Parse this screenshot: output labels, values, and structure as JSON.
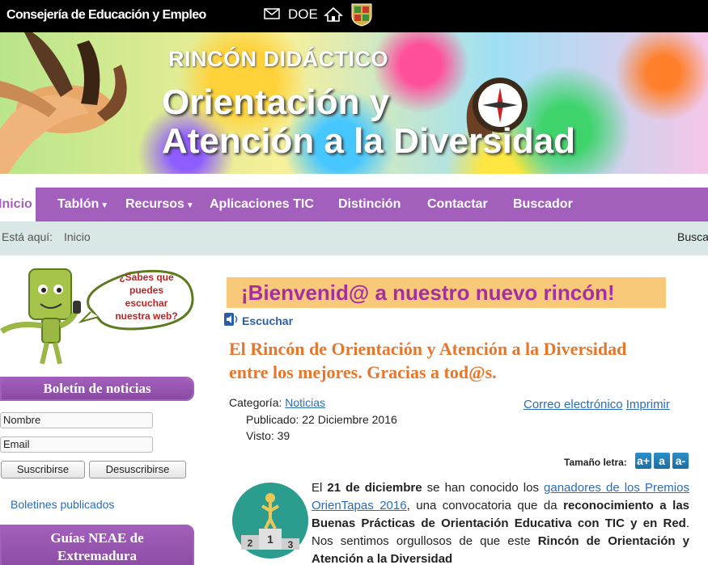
{
  "topbar": {
    "organization": "Consejería de Educación y Empleo",
    "doe_label": "DOE"
  },
  "banner": {
    "subtitle": "RINCÓN DIDÁCTICO",
    "title_line1": "Orientación y",
    "title_line2": "Atención a la Diversidad"
  },
  "nav": {
    "items": [
      {
        "label": "Inicio",
        "active": true
      },
      {
        "label": "Tablón",
        "dropdown": true
      },
      {
        "label": "Recursos",
        "dropdown": true
      },
      {
        "label": "Aplicaciones TIC"
      },
      {
        "label": "Distinción"
      },
      {
        "label": "Contactar"
      },
      {
        "label": "Buscador"
      }
    ]
  },
  "breadcrumb": {
    "prefix": "Está aquí:",
    "current": "Inicio",
    "search_cut": "Busca"
  },
  "sidebar": {
    "bubble_text": "¿Sabes que puedes escuchar nuestra web?",
    "newsletter_title": "Boletín de noticias",
    "name_placeholder": "Nombre",
    "email_placeholder": "Email",
    "subscribe_label": "Suscribirse",
    "unsubscribe_label": "Desuscribirse",
    "published_link": "Boletines publicados",
    "neae_title_line1": "Guías NEAE de",
    "neae_title_line2": "Extremadura"
  },
  "main": {
    "welcome": "¡Bienvenid@ a nuestro nuevo rincón!",
    "listen_label": "Escuchar",
    "article_title": "El Rincón de Orientación y Atención a la Diversidad entre los mejores. Gracias a tod@s.",
    "category_label": "Categoría:",
    "category_value": "Noticias",
    "published": "Publicado: 22 Diciembre 2016",
    "views": "Visto: 39",
    "email_action": "Correo electrónico",
    "print_action": "Imprimir",
    "font_size_label": "Tamaño letra:",
    "font_buttons": [
      "a+",
      "a",
      "a-"
    ],
    "body": {
      "p1_a": "El ",
      "p1_b": "21 de diciembre",
      "p1_c": " se han conocido los ",
      "p1_link": "ganadores de los Premios OrienTapas 2016",
      "p1_d": ", una convocatoria que da ",
      "p1_e": "reconocimiento a las Buenas Prácticas de Orientación Educativa con TIC y en Red",
      "p1_f": ". Nos sentimos orgullosos de que este ",
      "p1_g": "Rincón de Orientación y Atención a la Diversidad"
    }
  },
  "colors": {
    "nav_purple": "#a25fbb",
    "welcome_bg": "#f9c97a",
    "welcome_text": "#a52ea0",
    "title_orange": "#e8762a",
    "link_blue": "#2a6db5"
  }
}
